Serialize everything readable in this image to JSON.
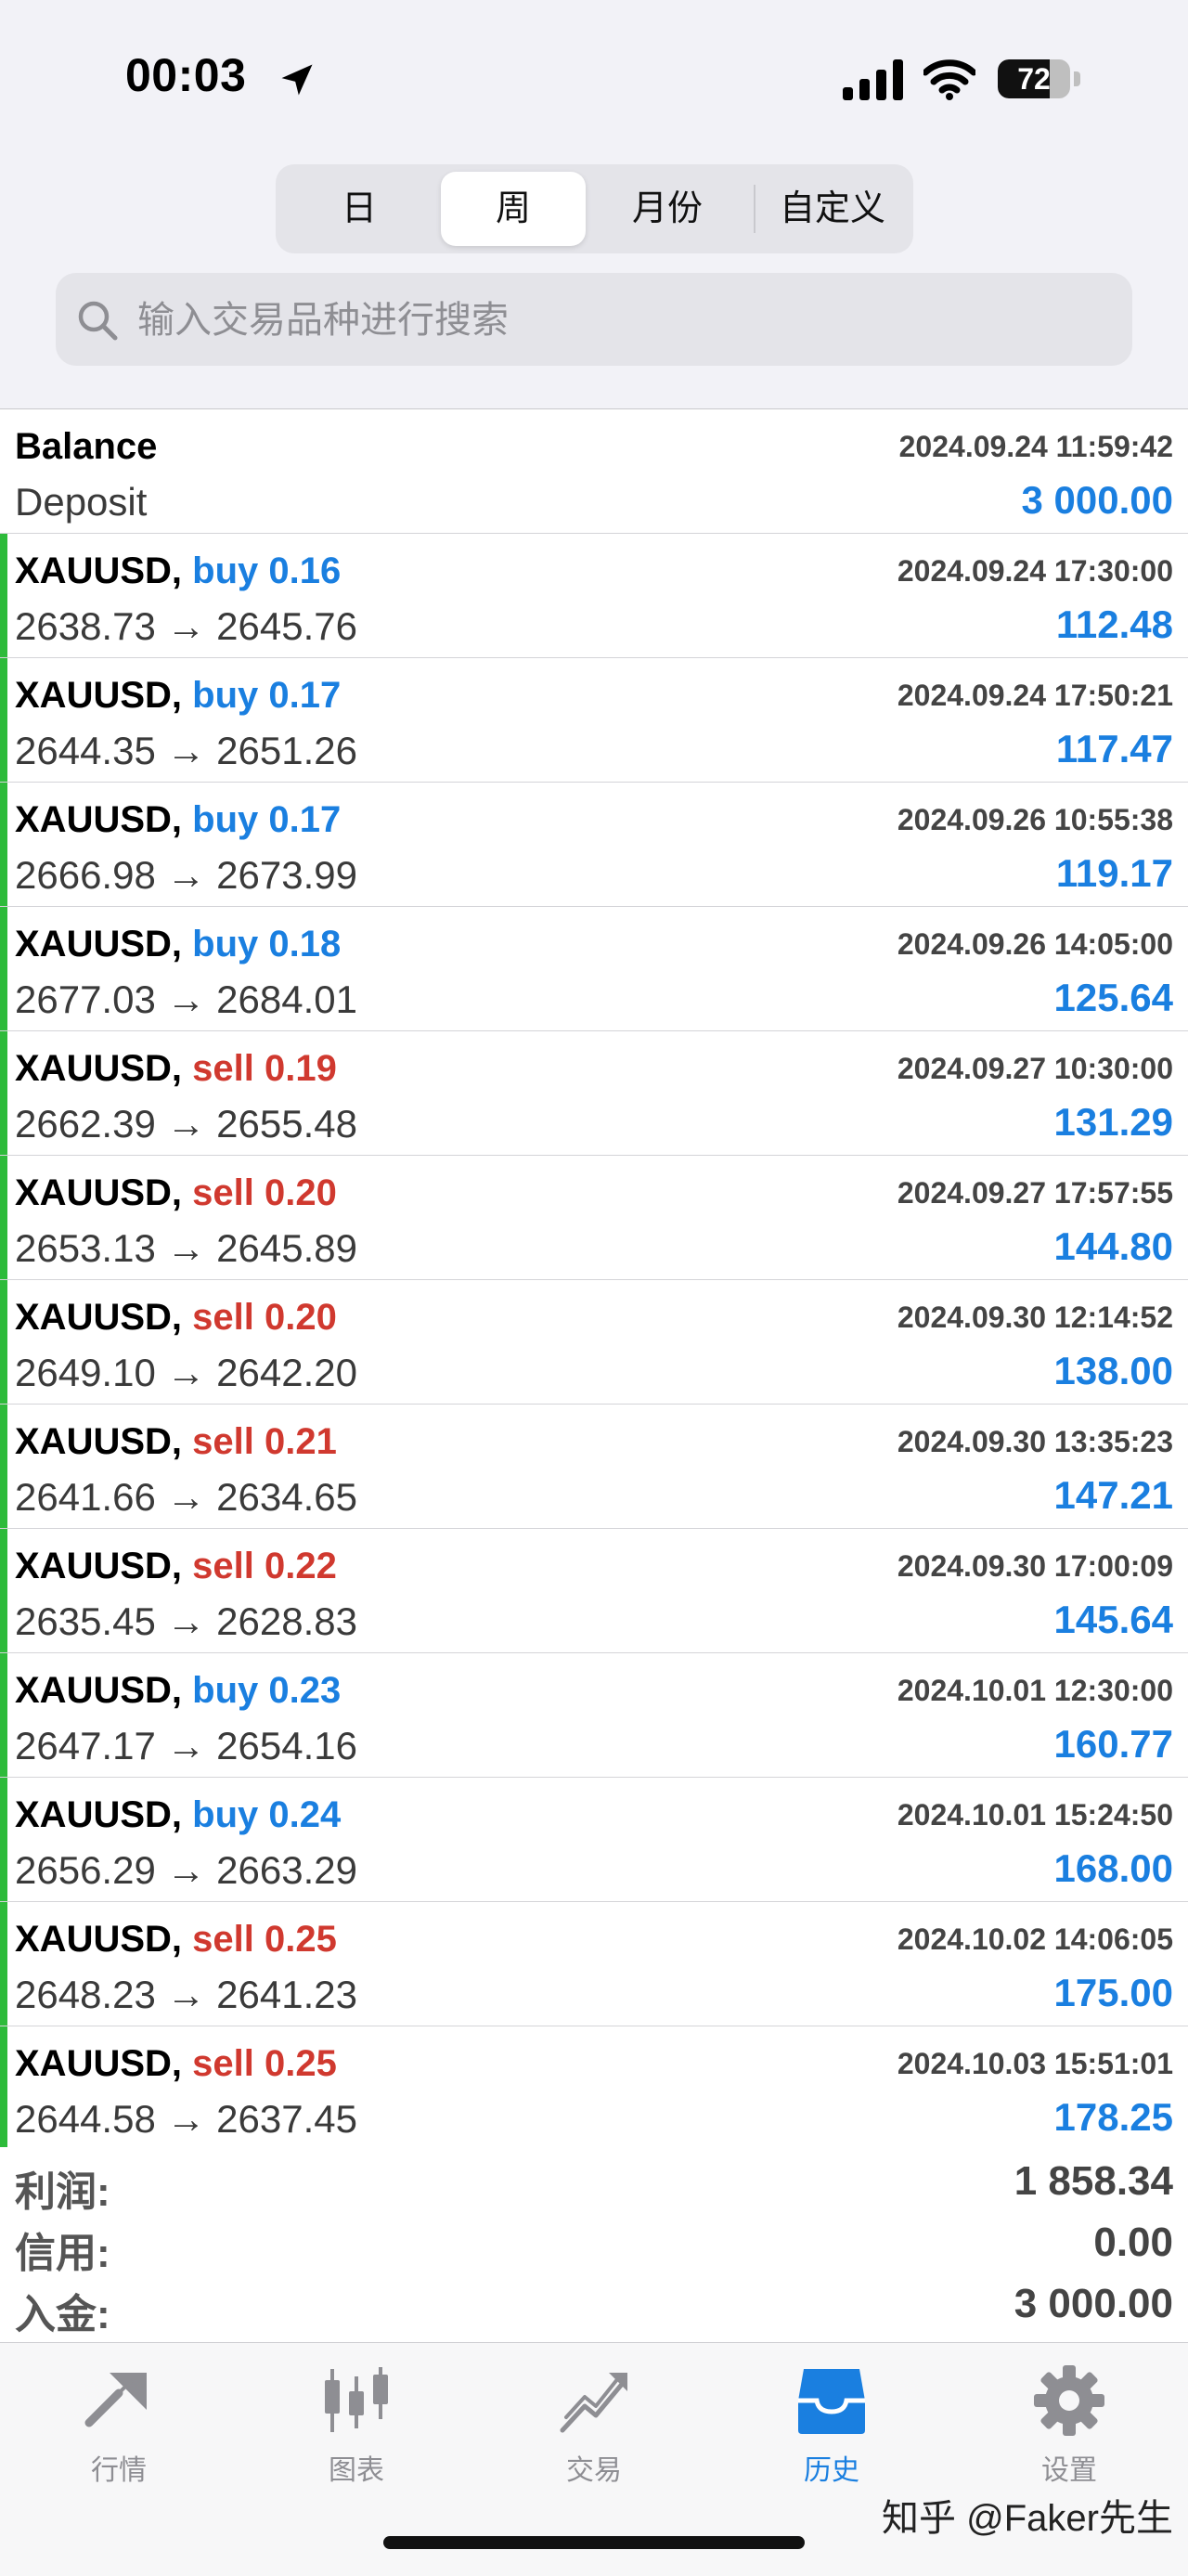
{
  "status_bar": {
    "time": "00:03",
    "battery": "72",
    "battery_level": 0.72
  },
  "segments": [
    {
      "label": "日",
      "active": false
    },
    {
      "label": "周",
      "active": true
    },
    {
      "label": "月份",
      "active": false
    },
    {
      "label": "自定义",
      "active": false
    }
  ],
  "search": {
    "placeholder": "输入交易品种进行搜索"
  },
  "balance": {
    "title": "Balance",
    "date": "2024.09.24 11:59:42",
    "type": "Deposit",
    "amount": "3 000.00"
  },
  "deals": [
    {
      "symbol": "XAUUSD,",
      "dir": "buy",
      "lot": "0.16",
      "date": "2024.09.24 17:30:00",
      "open": "2638.73",
      "close": "2645.76",
      "profit": "112.48"
    },
    {
      "symbol": "XAUUSD,",
      "dir": "buy",
      "lot": "0.17",
      "date": "2024.09.24 17:50:21",
      "open": "2644.35",
      "close": "2651.26",
      "profit": "117.47"
    },
    {
      "symbol": "XAUUSD,",
      "dir": "buy",
      "lot": "0.17",
      "date": "2024.09.26 10:55:38",
      "open": "2666.98",
      "close": "2673.99",
      "profit": "119.17"
    },
    {
      "symbol": "XAUUSD,",
      "dir": "buy",
      "lot": "0.18",
      "date": "2024.09.26 14:05:00",
      "open": "2677.03",
      "close": "2684.01",
      "profit": "125.64"
    },
    {
      "symbol": "XAUUSD,",
      "dir": "sell",
      "lot": "0.19",
      "date": "2024.09.27 10:30:00",
      "open": "2662.39",
      "close": "2655.48",
      "profit": "131.29"
    },
    {
      "symbol": "XAUUSD,",
      "dir": "sell",
      "lot": "0.20",
      "date": "2024.09.27 17:57:55",
      "open": "2653.13",
      "close": "2645.89",
      "profit": "144.80"
    },
    {
      "symbol": "XAUUSD,",
      "dir": "sell",
      "lot": "0.20",
      "date": "2024.09.30 12:14:52",
      "open": "2649.10",
      "close": "2642.20",
      "profit": "138.00"
    },
    {
      "symbol": "XAUUSD,",
      "dir": "sell",
      "lot": "0.21",
      "date": "2024.09.30 13:35:23",
      "open": "2641.66",
      "close": "2634.65",
      "profit": "147.21"
    },
    {
      "symbol": "XAUUSD,",
      "dir": "sell",
      "lot": "0.22",
      "date": "2024.09.30 17:00:09",
      "open": "2635.45",
      "close": "2628.83",
      "profit": "145.64"
    },
    {
      "symbol": "XAUUSD,",
      "dir": "buy",
      "lot": "0.23",
      "date": "2024.10.01 12:30:00",
      "open": "2647.17",
      "close": "2654.16",
      "profit": "160.77"
    },
    {
      "symbol": "XAUUSD,",
      "dir": "buy",
      "lot": "0.24",
      "date": "2024.10.01 15:24:50",
      "open": "2656.29",
      "close": "2663.29",
      "profit": "168.00"
    },
    {
      "symbol": "XAUUSD,",
      "dir": "sell",
      "lot": "0.25",
      "date": "2024.10.02 14:06:05",
      "open": "2648.23",
      "close": "2641.23",
      "profit": "175.00"
    },
    {
      "symbol": "XAUUSD,",
      "dir": "sell",
      "lot": "0.25",
      "date": "2024.10.03 15:51:01",
      "open": "2644.58",
      "close": "2637.45",
      "profit": "178.25"
    }
  ],
  "arrow": "→",
  "summary": [
    {
      "label": "利润:",
      "value": "1 858.34"
    },
    {
      "label": "信用:",
      "value": "0.00"
    },
    {
      "label": "入金:",
      "value": "3 000.00"
    }
  ],
  "tabs": [
    {
      "label": "行情",
      "icon": "quotes-icon",
      "active": false
    },
    {
      "label": "图表",
      "icon": "chart-icon",
      "active": false
    },
    {
      "label": "交易",
      "icon": "trade-icon",
      "active": false
    },
    {
      "label": "历史",
      "icon": "history-icon",
      "active": true
    },
    {
      "label": "设置",
      "icon": "settings-icon",
      "active": false
    }
  ],
  "watermark": "知乎 @Faker先生",
  "colors": {
    "accent": "#1a7fe0",
    "sell": "#d0392f",
    "deal_bar": "#2dbb3a"
  }
}
